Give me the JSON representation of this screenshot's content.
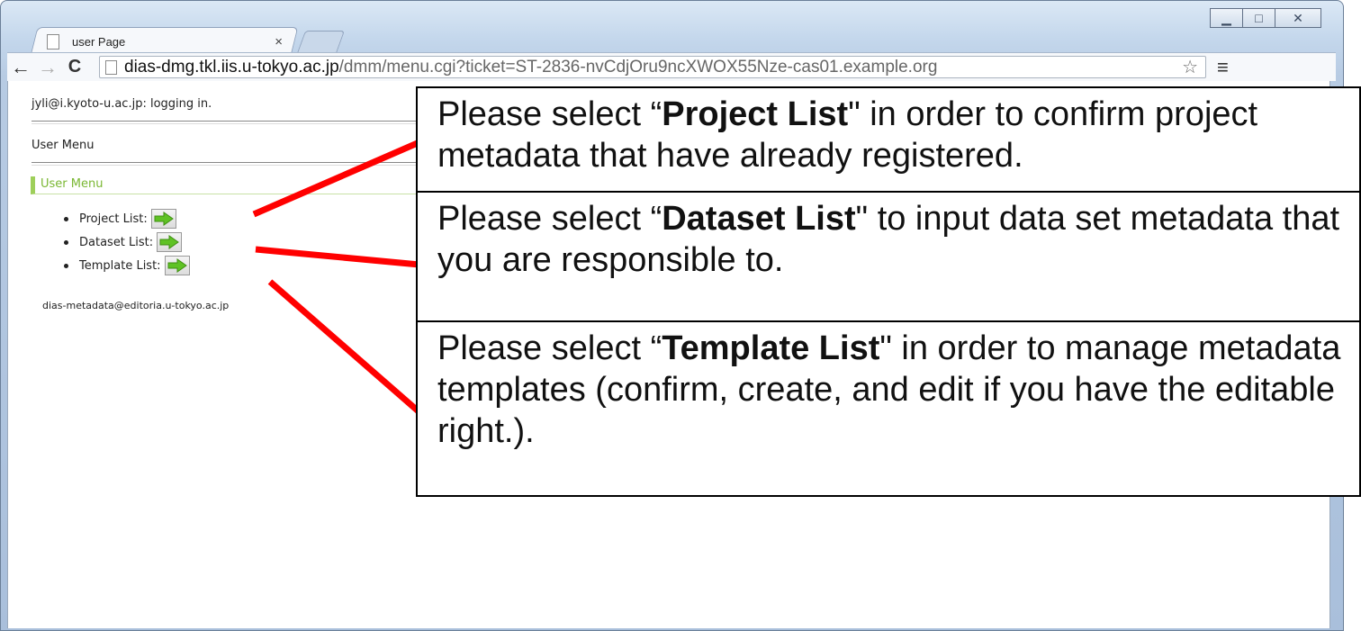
{
  "window": {
    "controls": {
      "minimize": "▁",
      "maximize": "□",
      "close": "✕"
    }
  },
  "tab": {
    "title": "user Page",
    "close": "×"
  },
  "toolbar": {
    "back": "←",
    "forward": "→",
    "reload": "C",
    "url_host": "dias-dmg.tkl.iis.u-tokyo.ac.jp",
    "url_path": "/dmm/menu.cgi?ticket=ST-2836-nvCdjOru9ncXWOX55Nze-cas01.example.org",
    "star": "☆",
    "menu": "≡"
  },
  "page": {
    "login_status": "jyli@i.kyoto-u.ac.jp: logging in.",
    "menu_heading": "User Menu",
    "section_title": "User Menu",
    "menu_items": [
      {
        "label": "Project List:"
      },
      {
        "label": "Dataset List:"
      },
      {
        "label": "Template List:"
      }
    ],
    "footer_email": "dias-metadata@editoria.u-tokyo.ac.jp"
  },
  "callouts": [
    {
      "pre": "Please select “",
      "bold": "Project List",
      "post": "\" in order to confirm project metadata that have already registered."
    },
    {
      "pre": "Please select “",
      "bold": "Dataset List",
      "post": "\" to input data set metadata that you are responsible to."
    },
    {
      "pre": "Please select “",
      "bold": "Template List",
      "post": "\" in order to manage metadata templates (confirm, create, and edit if you have the editable right.)."
    }
  ],
  "colors": {
    "accent_green": "#7ab733",
    "callout_line": "#ff0000"
  }
}
